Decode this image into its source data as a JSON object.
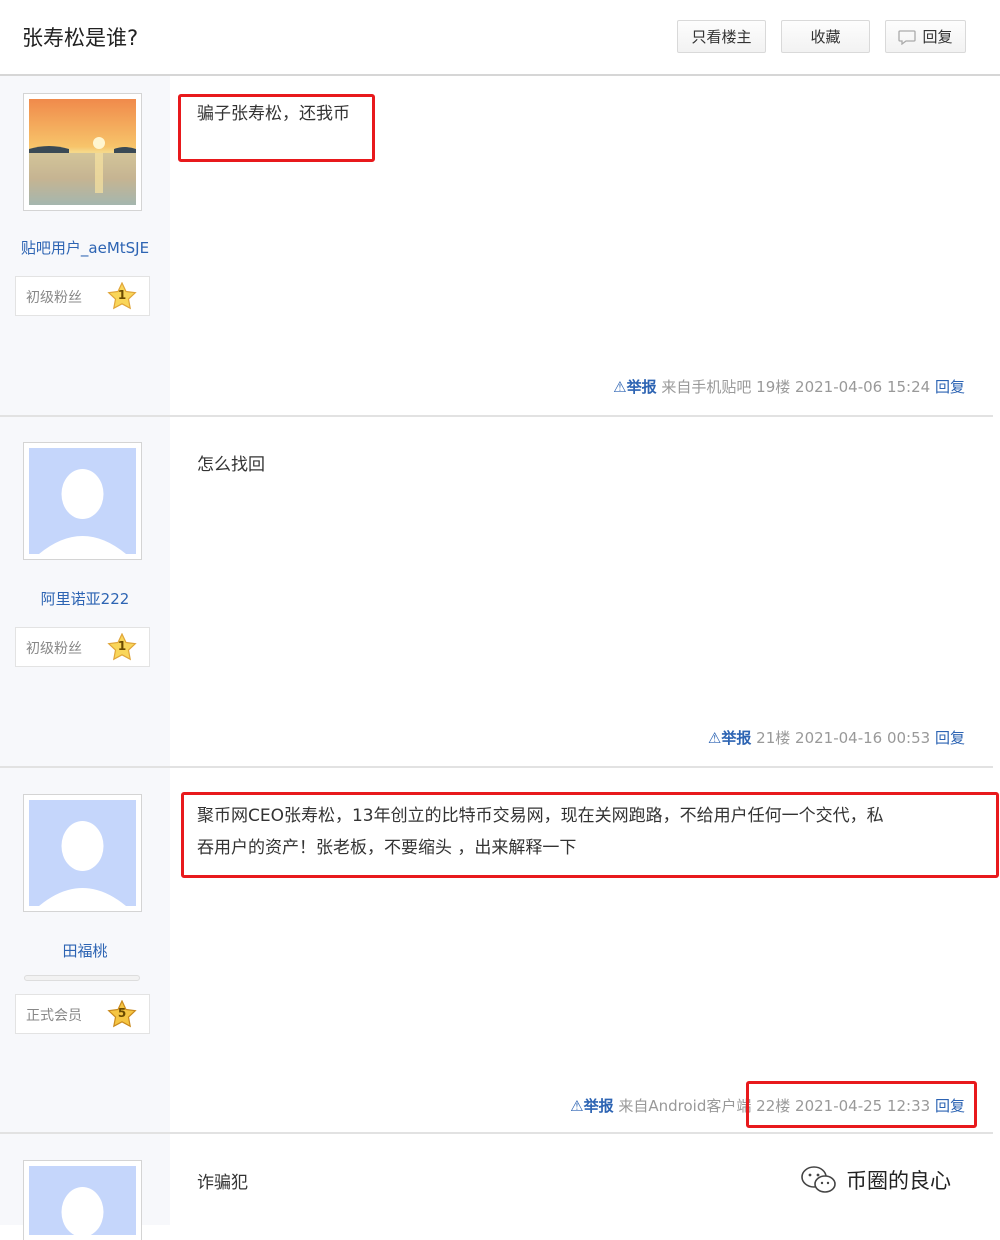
{
  "header": {
    "title": "张寿松是谁?",
    "only_op": "只看楼主",
    "favorite": "收藏",
    "reply": "回复"
  },
  "posts": [
    {
      "username": "贴吧用户_aeMtSJE",
      "level_text": "初级粉丝",
      "level_num": "1",
      "content": "骗子张寿松，还我币",
      "report": "举报",
      "source": "来自手机贴吧",
      "floor": "19楼",
      "time": "2021-04-06 15:24",
      "reply": "回复"
    },
    {
      "username": "阿里诺亚222",
      "level_text": "初级粉丝",
      "level_num": "1",
      "content": "怎么找回",
      "report": "举报",
      "floor": "21楼",
      "time": "2021-04-16 00:53",
      "reply": "回复"
    },
    {
      "username": "田福桃",
      "level_text": "正式会员",
      "level_num": "5",
      "content_line1": "聚币网CEO张寿松，13年创立的比特币交易网，现在关网跑路，不给用户任何一个交代，私",
      "content_line2": "吞用户的资产！张老板，不要缩头 ，出来解释一下",
      "report": "举报",
      "source": "来自Android客户端",
      "floor": "22楼",
      "time": "2021-04-25 12:33",
      "reply": "回复"
    },
    {
      "content": "诈骗犯"
    }
  ],
  "watermark": "币圈的良心",
  "colors": {
    "link": "#2d64b3",
    "highlight": "#e8191c",
    "sidebar": "#f7f8fb"
  }
}
